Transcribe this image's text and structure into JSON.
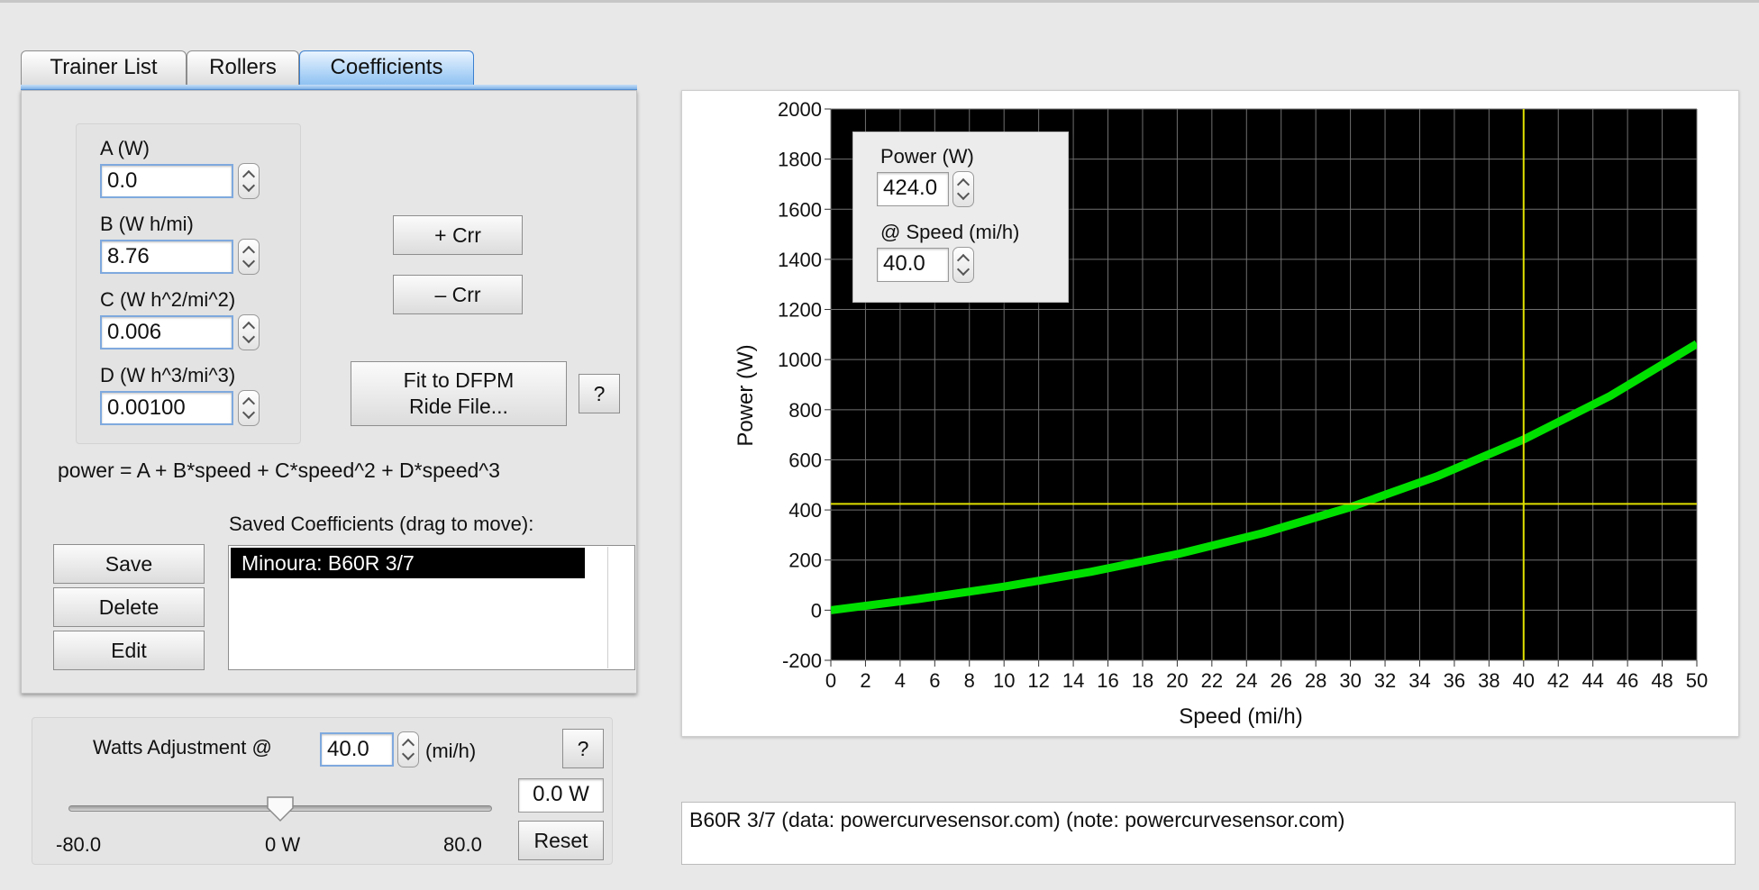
{
  "tabs": [
    {
      "label": "Trainer List"
    },
    {
      "label": "Rollers"
    },
    {
      "label": "Coefficients"
    }
  ],
  "coefficients": {
    "a_label": "A (W)",
    "a_value": "0.0",
    "b_label": "B (W h/mi)",
    "b_value": "8.76",
    "c_label": "C (W h^2/mi^2)",
    "c_value": "0.006",
    "d_label": "D (W h^3/mi^3)",
    "d_value": "0.00100"
  },
  "buttons": {
    "plus_crr": "+ Crr",
    "minus_crr": "– Crr",
    "fit": "Fit to DFPM\nRide File...",
    "help": "?",
    "save": "Save",
    "delete": "Delete",
    "edit": "Edit",
    "reset": "Reset"
  },
  "formula": "power = A + B*speed + C*speed^2 + D*speed^3",
  "saved": {
    "title": "Saved Coefficients (drag to move):",
    "items": [
      "Minoura: B60R 3/7"
    ]
  },
  "watts": {
    "label": "Watts Adjustment @",
    "speed": "40.0",
    "unit": "(mi/h)",
    "readout": "0.0 W",
    "slider_min": "-80.0",
    "slider_mid": "0 W",
    "slider_max": "80.0",
    "slider_min_value": -80,
    "slider_max_value": 80,
    "slider_value": 0
  },
  "cursor": {
    "power_label": "Power (W)",
    "power_value": "424.0",
    "speed_label": "@ Speed (mi/h)",
    "speed_value": "40.0"
  },
  "note": "B60R 3/7 (data: powercurvesensor.com) (note: powercurvesensor.com)",
  "colors": {
    "plot_bg": "#000000",
    "grid": "#707070",
    "curve": "#00e000",
    "crosshair": "#e0e000"
  },
  "chart_data": {
    "type": "line",
    "title": "",
    "xlabel": "Speed (mi/h)",
    "ylabel": "Power (W)",
    "xlim": [
      0,
      50
    ],
    "ylim": [
      -200,
      2000
    ],
    "xticks": [
      0,
      2,
      4,
      6,
      8,
      10,
      12,
      14,
      16,
      18,
      20,
      22,
      24,
      26,
      28,
      30,
      32,
      34,
      36,
      38,
      40,
      42,
      44,
      46,
      48,
      50
    ],
    "yticks": [
      -200,
      0,
      200,
      400,
      600,
      800,
      1000,
      1200,
      1400,
      1600,
      1800,
      2000
    ],
    "grid": true,
    "series": [
      {
        "x": [
          0,
          5,
          10,
          15,
          20,
          25,
          30,
          35,
          40,
          45,
          50
        ],
        "y": [
          0,
          44.0,
          94.2,
          153.1,
          223.6,
          308.6,
          411.2,
          534.2,
          681.0,
          854.9,
          1063.0
        ]
      }
    ],
    "crosshair": {
      "x": 40,
      "y": 424
    }
  }
}
